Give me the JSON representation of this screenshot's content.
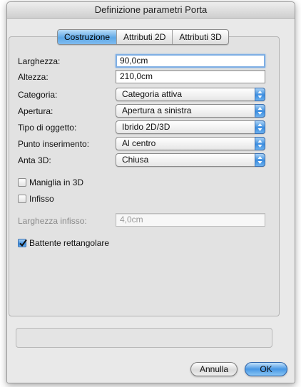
{
  "window": {
    "title": "Definizione parametri Porta"
  },
  "tabs": [
    {
      "label": "Costruzione",
      "active": true
    },
    {
      "label": "Attributi 2D",
      "active": false
    },
    {
      "label": "Attributi 3D",
      "active": false
    }
  ],
  "fields": {
    "larghezza": {
      "label": "Larghezza:",
      "value": "90,0cm"
    },
    "altezza": {
      "label": "Altezza:",
      "value": "210,0cm"
    },
    "larghezza_infisso": {
      "label": "Larghezza infisso:",
      "value": "4,0cm"
    }
  },
  "popups": {
    "categoria": {
      "label": "Categoria:",
      "value": "Categoria attiva"
    },
    "apertura": {
      "label": "Apertura:",
      "value": "Apertura a sinistra"
    },
    "tipo_oggetto": {
      "label": "Tipo di oggetto:",
      "value": "Ibrido 2D/3D"
    },
    "punto_inserimento": {
      "label": "Punto inserimento:",
      "value": "Al centro"
    },
    "anta_3d": {
      "label": "Anta 3D:",
      "value": "Chiusa"
    }
  },
  "checkboxes": {
    "maniglia": {
      "label": "Maniglia in 3D",
      "checked": false
    },
    "infisso": {
      "label": "Infisso",
      "checked": false
    },
    "battente": {
      "label": "Battente rettangolare",
      "checked": true
    }
  },
  "buttons": {
    "cancel": "Annulla",
    "ok": "OK"
  },
  "colors": {
    "accent": "#3b8de0",
    "window_bg": "#e9e9e9"
  }
}
